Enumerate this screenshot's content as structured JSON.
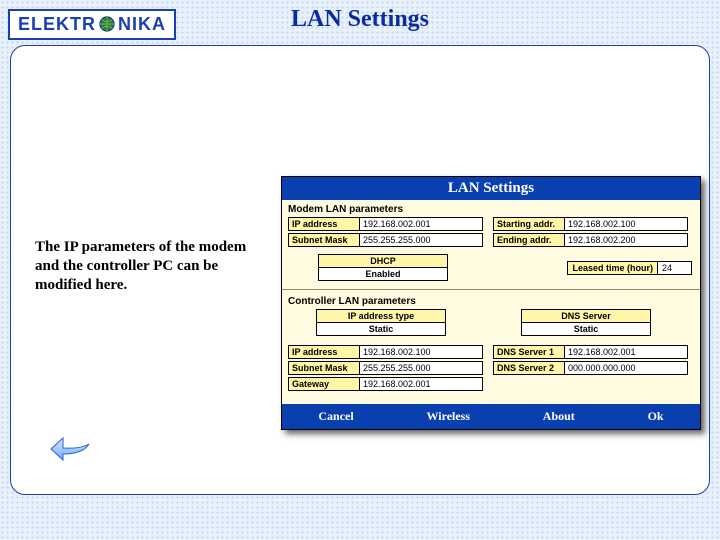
{
  "logo": {
    "left": "ELEKTR",
    "right": "NIKA"
  },
  "title": "LAN Settings",
  "description": "The IP parameters of the modem and the controller PC can be modified here.",
  "win": {
    "title": "LAN Settings",
    "modem": {
      "heading": "Modem LAN parameters",
      "ip_label": "IP address",
      "ip_value": "192.168.002.001",
      "mask_label": "Subnet Mask",
      "mask_value": "255.255.255.000",
      "start_label": "Starting addr.",
      "start_value": "192.168.002.100",
      "end_label": "Ending addr.",
      "end_value": "192.168.002.200",
      "dhcp_label": "DHCP",
      "dhcp_value": "Enabled",
      "leased_label": "Leased time (hour)",
      "leased_value": "24"
    },
    "controller": {
      "heading": "Controller LAN parameters",
      "iptype_label": "IP address type",
      "iptype_value": "Static",
      "dnssrv_label": "DNS Server",
      "dnssrv_value": "Static",
      "ip_label": "IP address",
      "ip_value": "192.168.002.100",
      "mask_label": "Subnet Mask",
      "mask_value": "255.255.255.000",
      "gw_label": "Gateway",
      "gw_value": "192.168.002.001",
      "dns1_label": "DNS Server 1",
      "dns1_value": "192.168.002.001",
      "dns2_label": "DNS Server 2",
      "dns2_value": "000.000.000.000"
    },
    "buttons": {
      "cancel": "Cancel",
      "wireless": "Wireless",
      "about": "About",
      "ok": "Ok"
    }
  }
}
